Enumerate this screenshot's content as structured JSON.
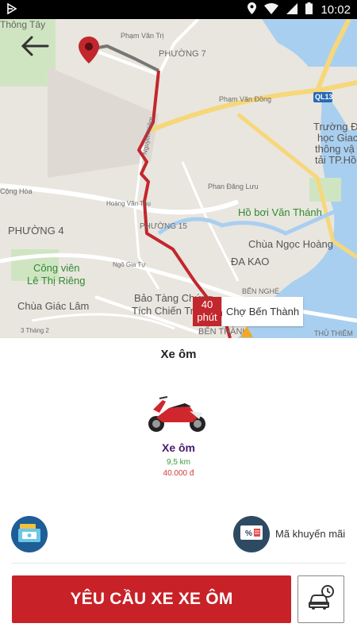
{
  "status_bar": {
    "time": "10:02",
    "icons": [
      "app-notification-icon",
      "location-icon",
      "wifi-icon",
      "signal-icon",
      "battery-icon"
    ]
  },
  "map": {
    "labels": {
      "thong_tay": "Thông Tây",
      "pham_van_tri": "Phạm Văn Trị",
      "phuong_7": "PHƯỜNG 7",
      "pham_van_dong": "Phạm Văn Đồng",
      "ql13": "QL13",
      "truong_1": "Trường Đ",
      "truong_2": "học Giac",
      "truong_3": "thông vậ",
      "truong_4": "tải TP.Hồ",
      "nguyen_kiem": "Nguyễn Kiệm",
      "phan_dang_luu": "Phan Đăng Lưu",
      "cong_hoa": "Cộng Hòa",
      "hoang_van_thu": "Hoàng Văn Thụ",
      "ho_boi": "Hồ bơi Văn Thánh",
      "phuong_4": "PHƯỜNG 4",
      "phuong_15": "PHƯỜNG 15",
      "cho_ngoc_hoang": "Chùa Ngọc Hoàng",
      "cong_vien_1": "Công viên",
      "cong_vien_2": "Lê Thị Riêng",
      "da_kao": "ĐA KAO",
      "chua_giac_lam": "Chùa Giác Lâm",
      "bao_tang_1": "Bảo Tàng Chứng",
      "bao_tang_2": "Tích Chiến Tr",
      "ben_nghe": "BẾN NGHÉ",
      "ben_thanh": "BẾN THÀNH",
      "thu_thiem": "THỦ THIÊM",
      "ba_thang_hai": "3 Tháng 2",
      "ngo_gia_tu": "Ngô Gia Tự"
    },
    "eta": "40 phút",
    "destination": "Chợ Bến Thành"
  },
  "panel": {
    "service_title": "Xe ôm",
    "vehicle_name": "Xe ôm",
    "distance": "9,5 km",
    "price": "40.000 đ",
    "promo_label": "Mã khuyến mãi",
    "request_button": "YÊU CẦU XE XE ÔM"
  },
  "colors": {
    "route": "#c2272d",
    "route_start": "#777777",
    "primary": "#c82128"
  }
}
